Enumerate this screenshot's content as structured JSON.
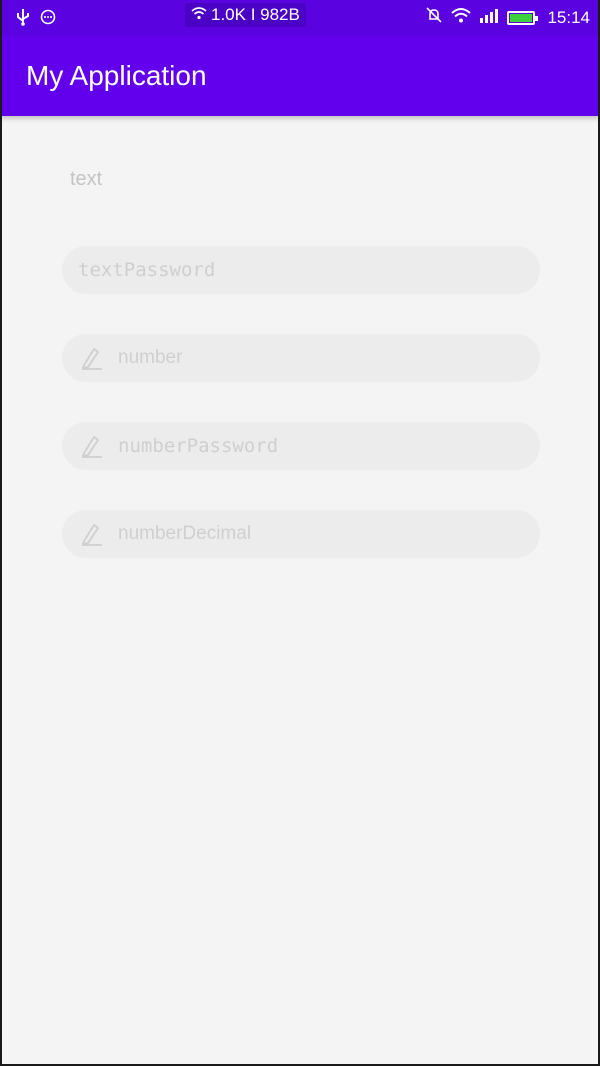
{
  "status_bar": {
    "network_speed": "1.0K I 982B",
    "time": "15:14",
    "icons": [
      "usb-icon",
      "message-icon",
      "wifi-icon",
      "mute-icon",
      "signal-icon",
      "battery-icon"
    ],
    "background": "#5a02e0"
  },
  "app_bar": {
    "title": "My Application",
    "background": "#6200ee"
  },
  "main": {
    "text_label": "text",
    "fields": [
      {
        "placeholder": "textPassword",
        "icon": null
      },
      {
        "placeholder": "number",
        "icon": "pencil-icon"
      },
      {
        "placeholder": "numberPassword",
        "icon": "pencil-icon"
      },
      {
        "placeholder": "numberDecimal",
        "icon": "pencil-icon"
      }
    ]
  }
}
